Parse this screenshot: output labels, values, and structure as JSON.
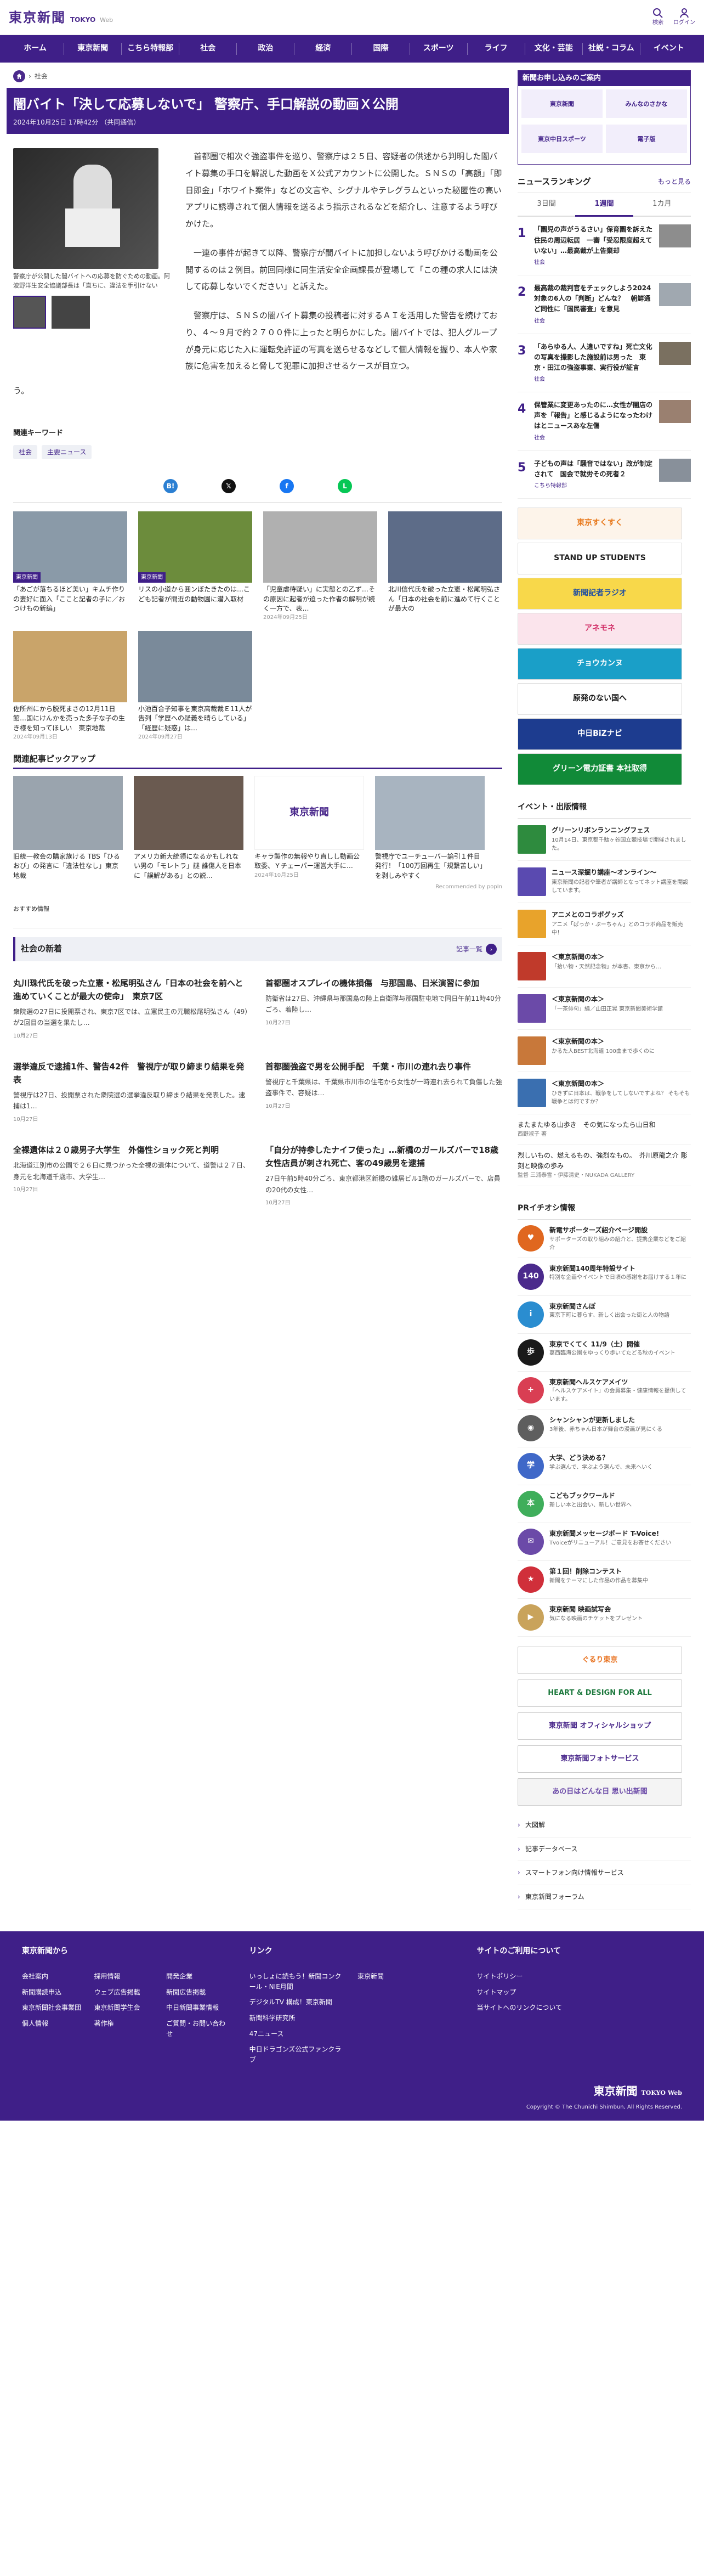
{
  "header": {
    "logo": "東京新聞",
    "logo_sub": "TOKYO",
    "logo_web": "Web",
    "search_label": "検索",
    "login_label": "ログイン"
  },
  "gnav": [
    "ホーム",
    "東京新聞",
    "こちら特報部",
    "社会",
    "政治",
    "経済",
    "国際",
    "スポーツ",
    "ライフ",
    "文化・芸能",
    "社説・コラム",
    "イベント"
  ],
  "breadcrumb": [
    "社会"
  ],
  "article": {
    "title": "闇バイト「決して応募しないで」 警察庁、手口解説の動画Ｘ公開",
    "date": "2024年10月25日 17時42分 （共同通信）",
    "caption": "警察庁が公開した闇バイトへの応募を防ぐための動画。阿波野洋生安全協議部長は「直ちに、違法を手引けない",
    "paragraphs": [
      "首都圏で相次ぐ強盗事件を巡り、警察庁は２５日、容疑者の供述から判明した闇バイト募集の手口を解説した動画をＸ公式アカウントに公開した。ＳＮＳの「高額」「即日即金」「ホワイト案件」などの文言や、シグナルやテレグラムといった秘匿性の高いアプリに誘導されて個人情報を送るよう指示されるなどを紹介し、注意するよう呼びかけた。",
      "一連の事件が起きて以降、警察庁が闇バイトに加担しないよう呼びかける動画を公開するのは２例目。前回同様に同生活安全企画課長が登場して「この種の求人には決して応募しないでください」と訴えた。",
      "警察庁は、ＳＮＳの闇バイト募集の投稿者に対するＡＩを活用した警告を続けており、４～９月で約２７００件に上ったと明らかにした。闇バイトでは、犯人グループが身元に応じた入に運転免許証の写真を送らせるなどして個人情報を握り、本人や家族に危害を加えると脅して犯罪に加担させるケースが目立つ。"
    ],
    "last_line": "う。"
  },
  "keywords": {
    "title": "関連キーワード",
    "items": [
      "社会",
      "主要ニュース"
    ]
  },
  "share": [
    {
      "name": "hatena-icon",
      "glyph": "B!",
      "color": "#2b7fd2"
    },
    {
      "name": "x-icon",
      "glyph": "𝕏",
      "color": "#111111"
    },
    {
      "name": "facebook-icon",
      "glyph": "f",
      "color": "#1877f2"
    },
    {
      "name": "line-icon",
      "glyph": "L",
      "color": "#06c755"
    }
  ],
  "related": [
    {
      "tag": "東京新聞",
      "text": "「あごが落ちるほど美い」キムチ作りの妻好に面入「ここと記者の子に／おつけもの新編」",
      "date": ""
    },
    {
      "tag": "東京新聞",
      "text": "リスの小道から囲ンぼたきたのは…こども記者が間近の動物園に潜入取材",
      "date": ""
    },
    {
      "tag": "",
      "text": "「児童虐待疑い」に実態との乙ず…その原因に起者が迫った作者の解明が続く一方で、表…",
      "date": "2024年09月25日"
    },
    {
      "tag": "",
      "text": "北川信代氏を破った立憲・松尾明弘さん「日本の社会を前に進めて行くことが最大の",
      "date": ""
    },
    {
      "tag": "",
      "text": "佐所州にから脱死まさの12月11日館…国にけんかを売った多子な子の生き様を知ってほしい　東京地裁",
      "date": "2024年09月13日"
    },
    {
      "tag": "",
      "text": "小池百合子知事を東京高裁裁Ｅ11人が告列「学歴への疑義を晴らしている」「経歴に疑惑」は…",
      "date": "2024年09月27日"
    }
  ],
  "pickup": {
    "title": "関連記事ピックアップ",
    "items": [
      {
        "text": "旧統一教会の購家族ける TBS「ひるおび」の発言に「違法性なし」東京地裁",
        "date": ""
      },
      {
        "text": "アメリカ新大統領になるかもしれない男の「モレトラ」謎 誰傷人を日本に「誤解がある」との説…",
        "date": ""
      },
      {
        "text": "キャラ製作の無報やり直しし動画公取委、Ｙチェーパー運営大手に…",
        "date": "2024年10月25日"
      },
      {
        "text": "警視庁でユーチューバー論引１件目発行！「100万回再生「規繋苦しい」を剥しみやすく",
        "date": ""
      }
    ],
    "recommended": "Recommended by popIn",
    "logo_text": "東京新聞"
  },
  "osusume": "おすすめ情報",
  "society_news": {
    "title": "社会の新着",
    "more": "記事一覧",
    "items": [
      {
        "title": "丸川珠代氏を破った立憲・松尾明弘さん「日本の社会を前へと進めていくことが最大の使命」　東京7区",
        "text": "衆院選の27日に投開票され、東京7区では、立憲民主の元職松尾明弘さん（49）が2回目の当選を果たし…",
        "date": "10月27日"
      },
      {
        "title": "首都圏オスプレイの機体損傷　与那国島、日米演習に参加",
        "text": "防衛省は27日、沖縄県与那国島の陸上自衛隊与那国駐屯地で同日午前11時40分ごろ、着陸し…",
        "date": "10月27日"
      },
      {
        "title": "選挙違反で逮捕1件、警告42件　警視庁が取り締まり結果を発表",
        "text": "警視庁は27日、投開票された衆院選の選挙違反取り締まり結果を発表した。逮捕は1…",
        "date": "10月27日"
      },
      {
        "title": "首都圏強盗で男を公開手配　千葉・市川の連れ去り事件",
        "text": "警視庁と千葉県は、千葉県市川市の住宅から女性が一時連れ去られて負傷した強盗事件で、容疑は…",
        "date": "10月27日"
      },
      {
        "title": "全裸遺体は２０歳男子大学生　外傷性ショック死と判明",
        "text": "北海道江別市の公園で２６日に見つかった全裸の遺体について、道警は２７日、身元を北海道千歳市、大学生…",
        "date": "10月27日"
      },
      {
        "title": "「自分が持参したナイフ使った」…新橋のガールズバーで18歳女性店員が刺され死亡、客の49歳男を逮捕",
        "text": "27日午前5時40分ごろ、東京都港区新橋の雑居ビル1階のガールズバーで、店員の20代の女性…",
        "date": "10月27日"
      }
    ]
  },
  "sidebar": {
    "ad_title": "新聞お申し込みのご案内",
    "ad_cells": [
      "東京新聞",
      "みんなのさかな",
      "東京中日スポーツ",
      "電子版"
    ],
    "ranking_title": "ニュースランキング",
    "ranking_more": "もっと見る",
    "ranking_tabs": [
      "3日間",
      "1週間",
      "1カ月"
    ],
    "ranking": [
      {
        "num": "1",
        "text": "「園児の声がうるさい」保育園を訴えた住民の周辺転居　一審「受忍限度超えていない」…最高裁が上告棄却",
        "cat": "社会"
      },
      {
        "num": "2",
        "text": "最高裁の裁判官をチェックしよう2024　対象の6人の「判断」どんな？　朝鮮通ど同性に「国民審査」を意見",
        "cat": "社会"
      },
      {
        "num": "3",
        "text": "「あらゆる人、人違いですね」死亡文化の写真を撮影した施設前は男った　東京・田江の強盗事業、実行役が証言",
        "cat": "社会"
      },
      {
        "num": "4",
        "text": "保管業に変更あったのに…女性が闇店の声を「報告」と感じるようになったわけはとニュースあな左傷",
        "cat": "社会"
      },
      {
        "num": "5",
        "text": "子どもの声は「騒音ではない」改が制定されて　国会で就労その死者２",
        "cat": "こちら特報部"
      }
    ],
    "banners": [
      {
        "label": "東京すくすく",
        "bg": "#fdf4ea",
        "fg": "#e87a1e"
      },
      {
        "label": "STAND UP STUDENTS",
        "bg": "#ffffff",
        "fg": "#222222"
      },
      {
        "label": "新聞記者ラジオ",
        "bg": "#f8d84a",
        "fg": "#2250a0"
      },
      {
        "label": "アネモネ",
        "bg": "#fbe4ec",
        "fg": "#d23169"
      },
      {
        "label": "チョウカンヌ",
        "bg": "#1a9fc8",
        "fg": "#ffffff"
      },
      {
        "label": "原発のない国へ",
        "bg": "#ffffff",
        "fg": "#111111"
      },
      {
        "label": "中日BiZナビ",
        "bg": "#1d3c8f",
        "fg": "#ffffff"
      },
      {
        "label": "グリーン電力証書 本社取得",
        "bg": "#118a38",
        "fg": "#ffffff"
      }
    ],
    "events_title": "イベント・出版情報",
    "events": [
      {
        "title": "グリーンリボンランニングフェス",
        "text": "10月14日、東京都千駄ヶ谷国立競技場で開催されました。",
        "color": "#2e8b3e"
      },
      {
        "title": "ニュース深掘り講座〜オンライン〜",
        "text": "東京新聞の記者や筆者が講師となってネット講座を開設しています。",
        "color": "#5a4ab0"
      },
      {
        "title": "アニメとのコラボグッズ",
        "text": "アニメ「ぱっか・ぷーちゃん」とのコラボ商品を販売中！",
        "color": "#e8a32b"
      },
      {
        "title": "＜東京新聞の本＞",
        "text": "「拾い物・天然記念物」が本書、東京から…",
        "color": "#c03a2b"
      },
      {
        "title": "＜東京新聞の本＞",
        "text": "「一茶俳句」編／山田正晃 東京新聞美術学館",
        "color": "#6b4aa8"
      },
      {
        "title": "＜東京新聞の本＞",
        "text": "かるた人BEST北海道 100曲まで歩くのに",
        "color": "#c8783a"
      },
      {
        "title": "＜東京新聞の本＞",
        "text": "ひきずに日本は、戦争をしてしないですよね？ そもそも戦争とは何ですか？",
        "color": "#3a6fb0"
      }
    ],
    "side_links": [
      {
        "text": "またまたゆる山歩き　その気になったら山日和",
        "sub": "西野淑子 著"
      },
      {
        "text": "烈しいもの、燃えるもの、強烈なもの。　芥川原龍之介 彫刻と映像の歩み",
        "sub": "監督 三浦泰雪・伊藤清史・NUKADA GALLERY"
      }
    ],
    "pr_title": "PRイチオシ情報",
    "pr_items": [
      {
        "title": "新電サポーターズ紹介ページ開設",
        "text": "サポーターズの取り組みの紹介と、提携企業などをご紹介",
        "color": "#e0671f",
        "glyph": "♥"
      },
      {
        "title": "東京新聞140周年特設サイト",
        "text": "特別な企画やイベントで日頃の感謝をお届けする１年に",
        "color": "#4b2a8c",
        "glyph": "140"
      },
      {
        "title": "東京新聞さんぽ",
        "text": "東京下町に暮らす、新しく出会った街と人の物語",
        "color": "#2a8dd0",
        "glyph": "i"
      },
      {
        "title": "東京でくてく 11/9（土）開催",
        "text": "葛西臨海公園をゆっくり歩いてたどる秋のイベント",
        "color": "#1a1a1a",
        "glyph": "歩"
      },
      {
        "title": "東京新聞ヘルスケアメイツ",
        "text": "「ヘルスケアメイト」の会員募集・健康情報を提供しています。",
        "color": "#d93e53",
        "glyph": "+"
      },
      {
        "title": "シャンシャンが更新しました",
        "text": "3年後、赤ちゃん日本が舞台の漫画が見にくる",
        "color": "#5e5e5e",
        "glyph": "◉"
      },
      {
        "title": "大学、どう決める？",
        "text": "学ぶ選んで、学ぶよう選んで、未来へいく",
        "color": "#3f68c8",
        "glyph": "学"
      },
      {
        "title": "こどもブックワールド",
        "text": "新しい本と出会い、新しい世界へ",
        "color": "#3fae5b",
        "glyph": "本"
      },
      {
        "title": "東京新聞メッセージボード T-Voice!",
        "text": "Tvoiceがリニューアル！ご意見をお寄せください",
        "color": "#6b4aa8",
        "glyph": "✉"
      },
      {
        "title": "第１回！削除コンテスト",
        "text": "新聞をテーマにした作品の作品を募集中",
        "color": "#d02f3a",
        "glyph": "★"
      },
      {
        "title": "東京新聞 映画試写会",
        "text": "気になる映画のチケットをプレゼント",
        "color": "#c9a35b",
        "glyph": "▶"
      }
    ],
    "bottom_banners": [
      {
        "label": "ぐるり東京",
        "bg": "#ffffff",
        "fg": "#e8711e"
      },
      {
        "label": "HEART & DESIGN FOR ALL",
        "bg": "#ffffff",
        "fg": "#1f7a3f"
      },
      {
        "label": "東京新聞 オフィシャルショップ",
        "bg": "#ffffff",
        "fg": "#4b2a8c"
      },
      {
        "label": "東京新聞フォトサービス",
        "bg": "#ffffff",
        "fg": "#4b2a8c"
      },
      {
        "label": "あの日はどんな日 思い出新聞",
        "bg": "#f4f4f4",
        "fg": "#6b4aa8"
      }
    ],
    "menu": [
      "大図解",
      "記事データベース",
      "スマートフォン向け情報サービス",
      "東京新聞フォーラム"
    ]
  },
  "footer": {
    "cols": [
      {
        "title": "東京新聞から",
        "layout": "three",
        "links": [
          "会社案内",
          "採用情報",
          "開発企業",
          "新聞購読申込",
          "ウェブ広告掲載",
          "新聞広告掲載",
          "東京新聞社会事業団",
          "東京新聞学生会",
          "中日新聞事業情報",
          "個人情報",
          "著作権",
          "ご質問・お問い合わせ"
        ]
      },
      {
        "title": "リンク",
        "layout": "two",
        "links": [
          "いっしょに読もう！新聞コンクール・NIE月間",
          "東京新聞",
          "デジタルTV 構成！東京新聞",
          "",
          "新聞科学研究所",
          "",
          "47ニュース",
          "",
          "中日ドラゴンズ公式ファンクラブ",
          ""
        ]
      },
      {
        "title": "サイトのご利用について",
        "layout": "one",
        "links": [
          "サイトポリシー",
          "サイトマップ",
          "当サイトへのリンクについて"
        ]
      }
    ],
    "logo": "東京新聞",
    "logo_sub": "TOKYO Web",
    "copyright": "Copyright © The Chunichi Shimbun, All Rights Reserved."
  }
}
